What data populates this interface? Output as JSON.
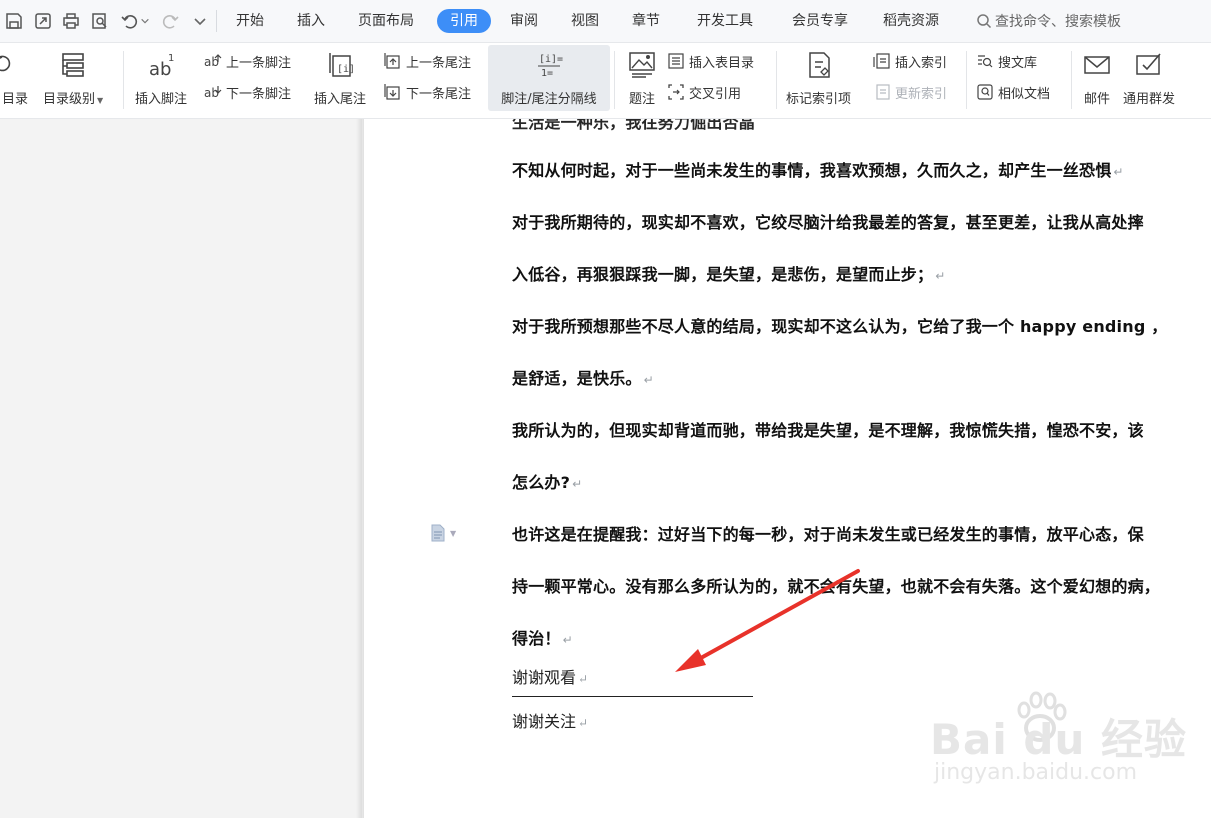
{
  "menubar": {
    "tabs": [
      {
        "label": "开始"
      },
      {
        "label": "插入"
      },
      {
        "label": "页面布局"
      },
      {
        "label": "引用"
      },
      {
        "label": "审阅"
      },
      {
        "label": "视图"
      },
      {
        "label": "章节"
      },
      {
        "label": "开发工具"
      },
      {
        "label": "会员专享"
      },
      {
        "label": "稻壳资源"
      }
    ],
    "active_tab": "引用",
    "search_placeholder": "查找命令、搜索模板"
  },
  "ribbon": {
    "toc": "目录",
    "toc_level": "目录级别",
    "insert_footnote": "插入脚注",
    "prev_footnote": "上一条脚注",
    "next_footnote": "下一条脚注",
    "insert_endnote": "插入尾注",
    "prev_endnote": "上一条尾注",
    "next_endnote": "下一条尾注",
    "note_separator": "脚注/尾注分隔线",
    "caption": "题注",
    "insert_table_of_figures": "插入表目录",
    "cross_reference": "交叉引用",
    "mark_index_entry": "标记索引项",
    "insert_index": "插入索引",
    "update_index": "更新索引",
    "search_library": "搜文库",
    "similar_docs": "相似文档",
    "mail": "邮件",
    "mass_mailing": "通用群发"
  },
  "document": {
    "paragraph_lines": [
      "不知从何时起，对于一些尚未发生的事情，我喜欢预想，久而久之，却产生一丝恐惧",
      "对于我所期待的，现实却不喜欢，它绞尽脑汁给我最差的答复，甚至更差，让我从高处摔",
      "入低谷，再狠狠踩我一脚，是失望，是悲伤，是望而止步；",
      "对于我所预想那些不尽人意的结局，现实却不这么认为，它给了我一个 happy ending ，",
      "是舒适，是快乐。",
      "我所认为的，但现实却背道而驰，带给我是失望，是不理解，我惊慌失措，惶恐不安，该",
      "怎么办?",
      "也许这是在提醒我：过好当下的每一秒，对于尚未发生或已经发生的事情，放平心态，保",
      "持一颗平常心。没有那么多所认为的，就不会有失望，也就不会有失落。这个爱幻想的病，",
      "得治！"
    ],
    "main_end_text": "谢谢观看",
    "footnote_text": "谢谢关注",
    "paragraph_mark": "↵"
  },
  "watermark": {
    "logo_text": "Bai du 经验",
    "url": "jingyan.baidu.com"
  },
  "colors": {
    "accent": "#3d8ef7",
    "arrow": "#e8322a"
  }
}
